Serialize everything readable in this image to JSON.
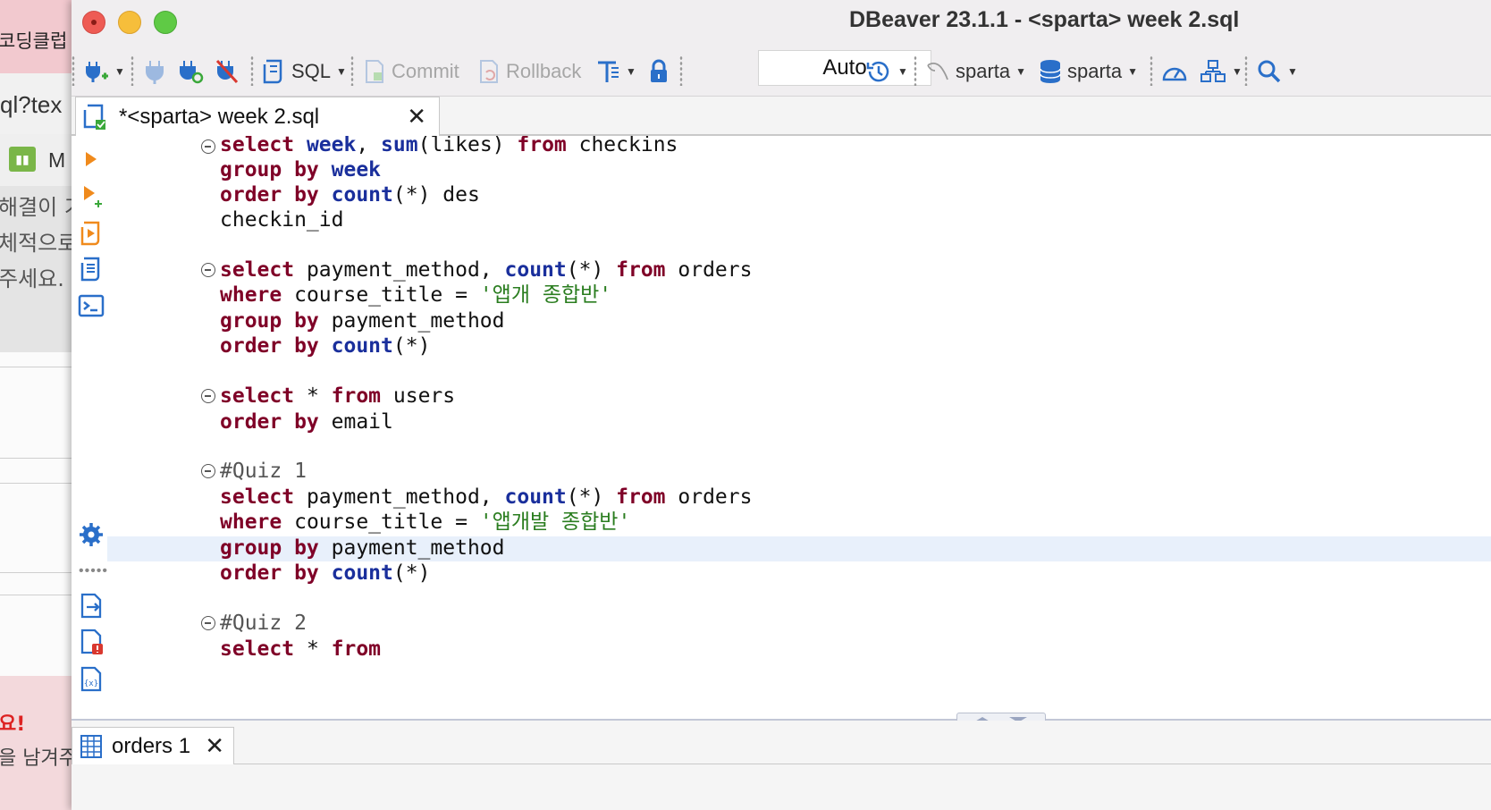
{
  "background_window": {
    "top_text": "코딩클럽",
    "url_text": "ql?tex",
    "tab_text": "M",
    "lines": [
      "해결이 기",
      "체적으로",
      "주세요."
    ],
    "alert_text": "요!",
    "bottom_text": "을 남겨주"
  },
  "window": {
    "title": "DBeaver 23.1.1 - <sparta> week 2.sql"
  },
  "toolbar": {
    "sql_label": "SQL",
    "commit_label": "Commit",
    "rollback_label": "Rollback",
    "transaction_mode": "Auto",
    "datasource_label": "sparta",
    "schema_label": "sparta"
  },
  "editor_tab": {
    "label": "*<sparta> week 2.sql"
  },
  "code_lines": [
    "select week, sum(likes) from checkins",
    "group by week",
    "order by count(*) des",
    "checkin_id",
    "",
    "select payment_method, count(*) from orders",
    "where course_title = '앱개 종합반'",
    "group by payment_method",
    "order by count(*)",
    "",
    "select * from users",
    "order by email",
    "",
    "#Quiz 1",
    "select payment_method, count(*) from orders",
    "where course_title = '앱개발 종합반'",
    "group by payment_method",
    "order by count(*)",
    "",
    "#Quiz 2",
    "select * from"
  ],
  "results": {
    "tab_label": "orders 1"
  },
  "colors": {
    "keyword": "#7f0027",
    "function": "#1a2f9c",
    "string": "#2a7d1f",
    "current_line": "#e8f0fb"
  }
}
